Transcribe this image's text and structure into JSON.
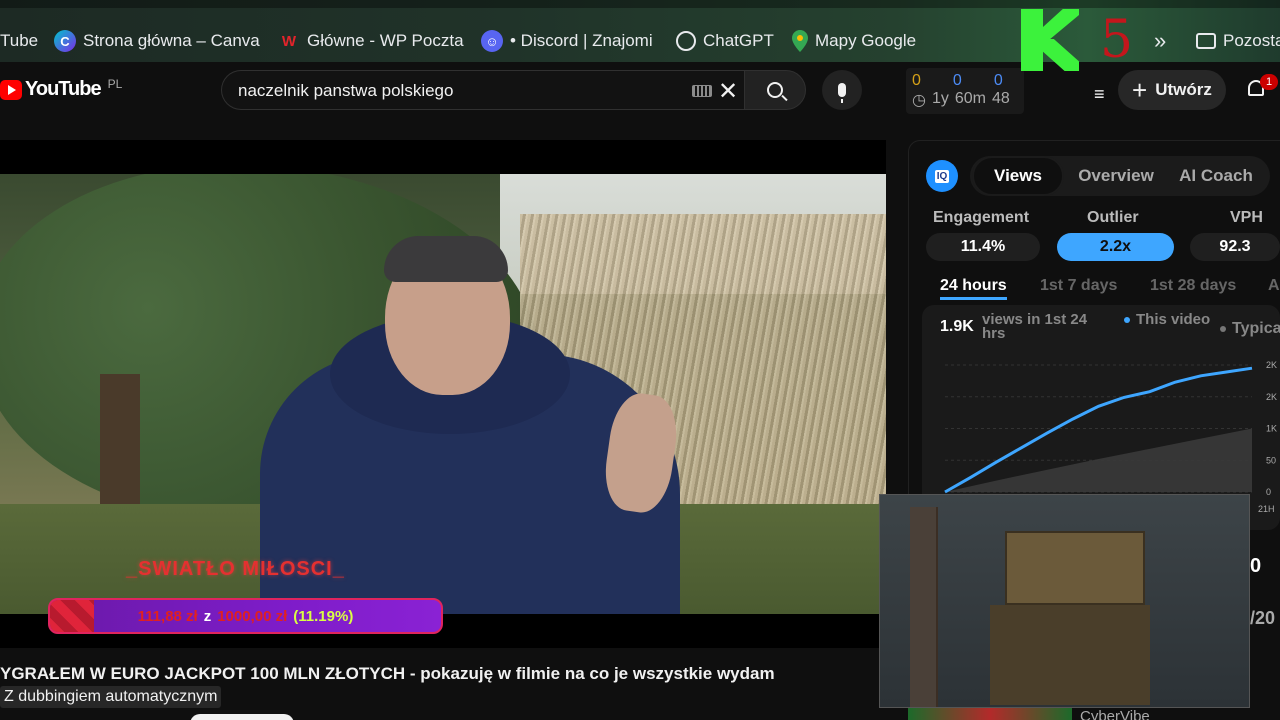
{
  "bookmarks": {
    "items": [
      {
        "label": "Tube",
        "icon": "youtube-icon"
      },
      {
        "label": "Strona główna – Canva",
        "icon": "canva-icon"
      },
      {
        "label": "Główne - WP Poczta",
        "icon": "wp-icon"
      },
      {
        "label": "• Discord | Znajomi",
        "icon": "discord-icon"
      },
      {
        "label": "ChatGPT",
        "icon": "chatgpt-icon"
      },
      {
        "label": "Mapy Google",
        "icon": "maps-icon"
      }
    ],
    "overflow_label": "Pozosta"
  },
  "header": {
    "logo_text": "YouTube",
    "country_code": "PL",
    "search_query": "naczelnik panstwa polskiego",
    "create_label": "Utwórz",
    "notification_count": "1",
    "ext_stats": {
      "counts": [
        "0",
        "0",
        "0"
      ],
      "times": [
        "1y",
        "60m",
        "48"
      ]
    },
    "overlay_digit": "5"
  },
  "video": {
    "overlay_title": "_SWIATŁO MIŁOSCI_",
    "goal": {
      "current": "111,88 zł",
      "separator": "z",
      "target": "1000,00 zł",
      "percent_label": "(11.19%)",
      "fraction": 0.1119
    },
    "title": "YGRAŁEM W EURO JACKPOT 100 MLN ZŁOTYCH - pokazuję w filmie na co je wszystkie wydam",
    "dubbing_label": "Z dubbingiem automatycznym"
  },
  "sidebar": {
    "badge": "IQ",
    "tabs": [
      {
        "label": "Views",
        "active": true
      },
      {
        "label": "Overview",
        "active": false
      },
      {
        "label": "AI Coach",
        "active": false
      }
    ],
    "metrics": [
      {
        "label": "Engagement",
        "value": "11.4%"
      },
      {
        "label": "Outlier",
        "value": "2.2x"
      },
      {
        "label": "VPH",
        "value": "92.3"
      }
    ],
    "periods": [
      {
        "label": "24 hours",
        "active": true
      },
      {
        "label": "1st 7 days",
        "active": false
      },
      {
        "label": "1st 28 days",
        "active": false
      },
      {
        "label": "A",
        "active": false
      }
    ],
    "chart_headline": "1.9K",
    "chart_subtitle": "views in 1st 24 hrs",
    "legend_this": "This video",
    "legend_typical": "Typica",
    "webcam_right_1": "0",
    "webcam_right_2": "/20",
    "bottom_channel": "CyberVibe"
  },
  "chart_data": {
    "type": "area",
    "title": "",
    "xlabel": "",
    "ylabel": "",
    "x_tick_labels": [
      "21H"
    ],
    "y_tick_labels": [
      "2K",
      "2K",
      "1K",
      "50",
      "0"
    ],
    "series": [
      {
        "name": "This video",
        "color": "#3ea6ff",
        "x": [
          0,
          2,
          4,
          6,
          8,
          10,
          12,
          14,
          16,
          18,
          20,
          22,
          24
        ],
        "y": [
          0,
          230,
          470,
          700,
          930,
          1150,
          1350,
          1490,
          1580,
          1730,
          1830,
          1890,
          1950
        ]
      },
      {
        "name": "Typica",
        "color": "#555555",
        "x": [
          0,
          4,
          8,
          12,
          16,
          20,
          24
        ],
        "y": [
          0,
          180,
          350,
          520,
          680,
          840,
          1000
        ]
      }
    ],
    "xlim": [
      0,
      24
    ],
    "ylim": [
      0,
      2000
    ],
    "grid": true
  },
  "colors": {
    "accent": "#3ea6ff",
    "youtube_red": "#ff0000",
    "goal_purple": "#7e1cc9",
    "k_green": "#3cf23c"
  }
}
